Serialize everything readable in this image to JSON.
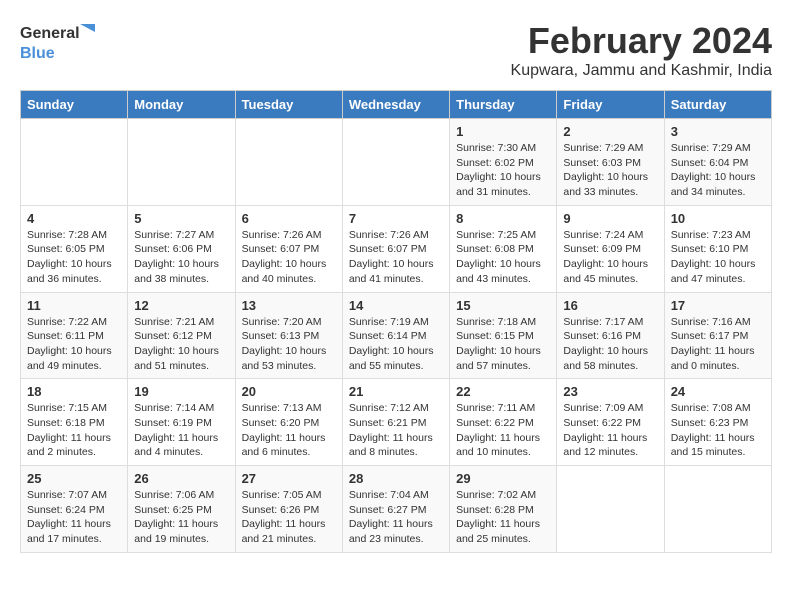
{
  "logo": {
    "text_general": "General",
    "text_blue": "Blue"
  },
  "title": "February 2024",
  "subtitle": "Kupwara, Jammu and Kashmir, India",
  "days_of_week": [
    "Sunday",
    "Monday",
    "Tuesday",
    "Wednesday",
    "Thursday",
    "Friday",
    "Saturday"
  ],
  "weeks": [
    [
      {
        "day": "",
        "info": ""
      },
      {
        "day": "",
        "info": ""
      },
      {
        "day": "",
        "info": ""
      },
      {
        "day": "",
        "info": ""
      },
      {
        "day": "1",
        "info": "Sunrise: 7:30 AM\nSunset: 6:02 PM\nDaylight: 10 hours\nand 31 minutes."
      },
      {
        "day": "2",
        "info": "Sunrise: 7:29 AM\nSunset: 6:03 PM\nDaylight: 10 hours\nand 33 minutes."
      },
      {
        "day": "3",
        "info": "Sunrise: 7:29 AM\nSunset: 6:04 PM\nDaylight: 10 hours\nand 34 minutes."
      }
    ],
    [
      {
        "day": "4",
        "info": "Sunrise: 7:28 AM\nSunset: 6:05 PM\nDaylight: 10 hours\nand 36 minutes."
      },
      {
        "day": "5",
        "info": "Sunrise: 7:27 AM\nSunset: 6:06 PM\nDaylight: 10 hours\nand 38 minutes."
      },
      {
        "day": "6",
        "info": "Sunrise: 7:26 AM\nSunset: 6:07 PM\nDaylight: 10 hours\nand 40 minutes."
      },
      {
        "day": "7",
        "info": "Sunrise: 7:26 AM\nSunset: 6:07 PM\nDaylight: 10 hours\nand 41 minutes."
      },
      {
        "day": "8",
        "info": "Sunrise: 7:25 AM\nSunset: 6:08 PM\nDaylight: 10 hours\nand 43 minutes."
      },
      {
        "day": "9",
        "info": "Sunrise: 7:24 AM\nSunset: 6:09 PM\nDaylight: 10 hours\nand 45 minutes."
      },
      {
        "day": "10",
        "info": "Sunrise: 7:23 AM\nSunset: 6:10 PM\nDaylight: 10 hours\nand 47 minutes."
      }
    ],
    [
      {
        "day": "11",
        "info": "Sunrise: 7:22 AM\nSunset: 6:11 PM\nDaylight: 10 hours\nand 49 minutes."
      },
      {
        "day": "12",
        "info": "Sunrise: 7:21 AM\nSunset: 6:12 PM\nDaylight: 10 hours\nand 51 minutes."
      },
      {
        "day": "13",
        "info": "Sunrise: 7:20 AM\nSunset: 6:13 PM\nDaylight: 10 hours\nand 53 minutes."
      },
      {
        "day": "14",
        "info": "Sunrise: 7:19 AM\nSunset: 6:14 PM\nDaylight: 10 hours\nand 55 minutes."
      },
      {
        "day": "15",
        "info": "Sunrise: 7:18 AM\nSunset: 6:15 PM\nDaylight: 10 hours\nand 57 minutes."
      },
      {
        "day": "16",
        "info": "Sunrise: 7:17 AM\nSunset: 6:16 PM\nDaylight: 10 hours\nand 58 minutes."
      },
      {
        "day": "17",
        "info": "Sunrise: 7:16 AM\nSunset: 6:17 PM\nDaylight: 11 hours\nand 0 minutes."
      }
    ],
    [
      {
        "day": "18",
        "info": "Sunrise: 7:15 AM\nSunset: 6:18 PM\nDaylight: 11 hours\nand 2 minutes."
      },
      {
        "day": "19",
        "info": "Sunrise: 7:14 AM\nSunset: 6:19 PM\nDaylight: 11 hours\nand 4 minutes."
      },
      {
        "day": "20",
        "info": "Sunrise: 7:13 AM\nSunset: 6:20 PM\nDaylight: 11 hours\nand 6 minutes."
      },
      {
        "day": "21",
        "info": "Sunrise: 7:12 AM\nSunset: 6:21 PM\nDaylight: 11 hours\nand 8 minutes."
      },
      {
        "day": "22",
        "info": "Sunrise: 7:11 AM\nSunset: 6:22 PM\nDaylight: 11 hours\nand 10 minutes."
      },
      {
        "day": "23",
        "info": "Sunrise: 7:09 AM\nSunset: 6:22 PM\nDaylight: 11 hours\nand 12 minutes."
      },
      {
        "day": "24",
        "info": "Sunrise: 7:08 AM\nSunset: 6:23 PM\nDaylight: 11 hours\nand 15 minutes."
      }
    ],
    [
      {
        "day": "25",
        "info": "Sunrise: 7:07 AM\nSunset: 6:24 PM\nDaylight: 11 hours\nand 17 minutes."
      },
      {
        "day": "26",
        "info": "Sunrise: 7:06 AM\nSunset: 6:25 PM\nDaylight: 11 hours\nand 19 minutes."
      },
      {
        "day": "27",
        "info": "Sunrise: 7:05 AM\nSunset: 6:26 PM\nDaylight: 11 hours\nand 21 minutes."
      },
      {
        "day": "28",
        "info": "Sunrise: 7:04 AM\nSunset: 6:27 PM\nDaylight: 11 hours\nand 23 minutes."
      },
      {
        "day": "29",
        "info": "Sunrise: 7:02 AM\nSunset: 6:28 PM\nDaylight: 11 hours\nand 25 minutes."
      },
      {
        "day": "",
        "info": ""
      },
      {
        "day": "",
        "info": ""
      }
    ]
  ]
}
